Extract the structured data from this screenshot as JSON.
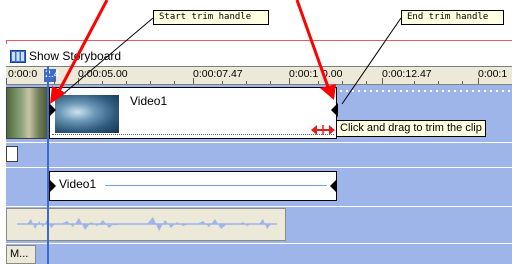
{
  "callouts": {
    "start_trim": "Start trim handle",
    "end_trim": "End trim handle"
  },
  "toolbar": {
    "show_storyboard": "Show Storyboard",
    "storyboard_icon": "filmstrip-icon"
  },
  "ruler": {
    "labels": [
      "0:00:0",
      "2.4",
      "0:00:05.00",
      "0:00:07.47",
      "0:00:1",
      "0.00",
      "0:00:12.47",
      "0:00:1"
    ]
  },
  "video_track": {
    "clip_name": "Video1"
  },
  "title_track": {
    "clip_name": "Video1"
  },
  "music_track": {
    "clip_name": "M..."
  },
  "tooltip": {
    "text": "Click and drag to trim the clip"
  },
  "colors": {
    "track_bg": "#9db5e8",
    "callout_arrow": "#ff0000",
    "playhead": "#3c6bc9",
    "callout_bg": "#ffffe1"
  }
}
